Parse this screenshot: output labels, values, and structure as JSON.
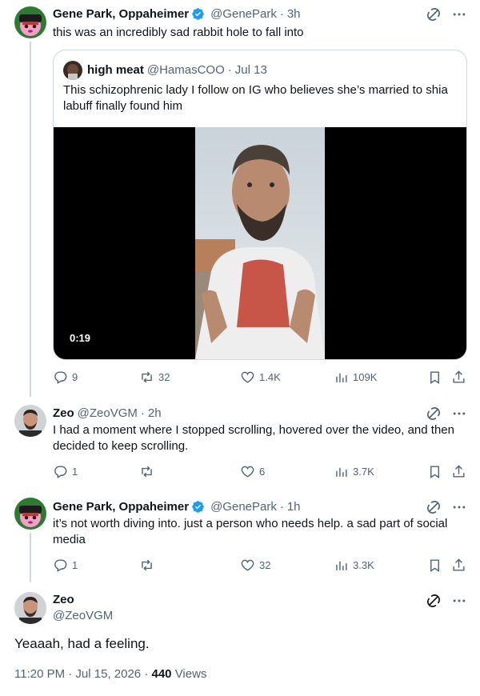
{
  "tweets": [
    {
      "name": "Gene Park, Oppaheimer",
      "handle": "@GenePark",
      "time": "3h",
      "text": "this was an incredibly sad rabbit hole to fall into",
      "quote": {
        "name": "high meat",
        "handle": "@HamasCOO",
        "time": "Jul 13",
        "text": "This schizophrenic lady I follow on IG who believes she’s married to shia labuff finally found him",
        "video_duration": "0:19"
      },
      "replies": "9",
      "reposts": "32",
      "likes": "1.4K",
      "views": "109K"
    },
    {
      "name": "Zeo",
      "handle": "@ZeoVGM",
      "time": "2h",
      "text": "I had a moment where I stopped scrolling, hovered over the video, and then decided to keep scrolling.",
      "replies": "1",
      "reposts": "",
      "likes": "6",
      "views": "3.7K"
    },
    {
      "name": "Gene Park, Oppaheimer",
      "handle": "@GenePark",
      "time": "1h",
      "text": "it’s not worth diving into. just a person who needs help. a sad part of social media",
      "replies": "1",
      "reposts": "",
      "likes": "32",
      "views": "3.3K"
    }
  ],
  "main": {
    "name": "Zeo",
    "handle": "@ZeoVGM",
    "text": "Yeaaah, had a feeling.",
    "timestamp": "11:20 PM · Jul 15, 2026",
    "views_count": "440",
    "views_label": "Views"
  },
  "separator": "·",
  "colors": {
    "verified": "#1d9bf0",
    "muted": "#536471",
    "border": "#cfd9de"
  }
}
